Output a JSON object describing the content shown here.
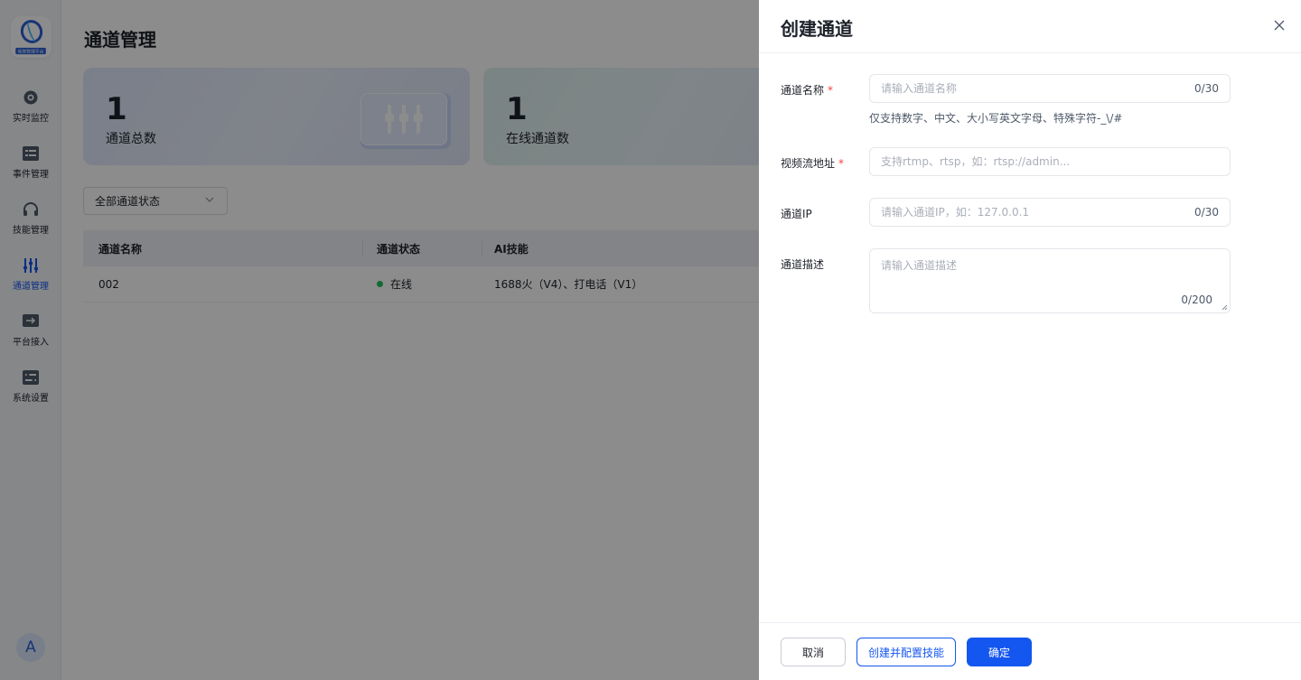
{
  "sidebar": {
    "logo_text": "视觉管理平台",
    "items": [
      {
        "label": "实时监控",
        "icon": "camera-icon"
      },
      {
        "label": "事件管理",
        "icon": "list-icon"
      },
      {
        "label": "技能管理",
        "icon": "headset-icon"
      },
      {
        "label": "通道管理",
        "icon": "sliders-icon",
        "active": true
      },
      {
        "label": "平台接入",
        "icon": "login-icon"
      },
      {
        "label": "系统设置",
        "icon": "settings-panel-icon"
      }
    ],
    "avatar": "A"
  },
  "main": {
    "title": "通道管理",
    "stats": [
      {
        "value": "1",
        "label": "通道总数"
      },
      {
        "value": "1",
        "label": "在线通道数"
      }
    ],
    "filter": {
      "value": "全部通道状态"
    },
    "table": {
      "columns": [
        "通道名称",
        "通道状态",
        "AI技能"
      ],
      "rows": [
        {
          "name": "002",
          "status": "在线",
          "skills": "1688火（V4）、打电话（V1）"
        }
      ]
    }
  },
  "drawer": {
    "title": "创建通道",
    "fields": {
      "name": {
        "label": "通道名称",
        "required_mark": "*",
        "placeholder": "请输入通道名称",
        "count": "0/30",
        "help": "仅支持数字、中文、大小写英文字母、特殊字符-_\\/#"
      },
      "stream": {
        "label": "视频流地址",
        "required_mark": "*",
        "placeholder": "支持rtmp、rtsp，如：rtsp://admin..."
      },
      "ip": {
        "label": "通道IP",
        "placeholder": "请输入通道IP，如：127.0.0.1",
        "count": "0/30"
      },
      "desc": {
        "label": "通道描述",
        "placeholder": "请输入通道描述",
        "count": "0/200"
      }
    },
    "buttons": {
      "cancel": "取消",
      "create_config": "创建并配置技能",
      "confirm": "确定"
    }
  },
  "colors": {
    "primary": "#1456f0",
    "online": "#21c35b",
    "required": "#f53f3f"
  }
}
